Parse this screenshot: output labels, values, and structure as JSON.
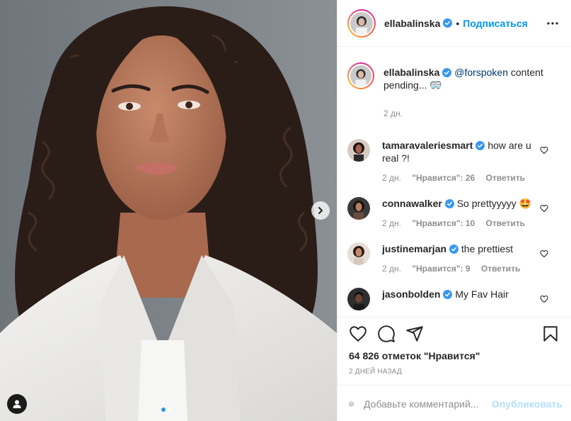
{
  "post": {
    "image_alt": "Portrait of a woman with curly dark hair wearing a white shirt",
    "carousel_dots": 2,
    "active_dot": 1
  },
  "header": {
    "username": "ellabalinska",
    "separator": "•",
    "follow_label": "Подписаться",
    "more_icon": "more-icon"
  },
  "caption": {
    "username": "ellabalinska",
    "mention": "@forspoken",
    "text": " content pending... 🥽",
    "time": "2 дн."
  },
  "comments": [
    {
      "username": "tamaravaleriesmart",
      "text": "how are u real ?!",
      "time": "2 дн.",
      "likes": "\"Нравится\": 26",
      "reply": "Ответить"
    },
    {
      "username": "connawalker",
      "text": "So prettyyyyy 🤩",
      "time": "2 дн.",
      "likes": "\"Нравится\": 10",
      "reply": "Ответить"
    },
    {
      "username": "justinemarjan",
      "text": "the prettiest",
      "time": "2 дн.",
      "likes": "\"Нравится\": 9",
      "reply": "Ответить"
    },
    {
      "username": "jasonbolden",
      "text": "My Fav Hair"
    }
  ],
  "actions": {
    "likes_count": "64 826 отметок \"Нравится\"",
    "posted": "2 дней назад"
  },
  "add_comment": {
    "placeholder": "Добавьте комментарий...",
    "publish_label": "Опубликовать"
  },
  "colors": {
    "accent": "#0095f6",
    "verified": "#3897f0",
    "publish_disabled": "#b2dffc"
  }
}
